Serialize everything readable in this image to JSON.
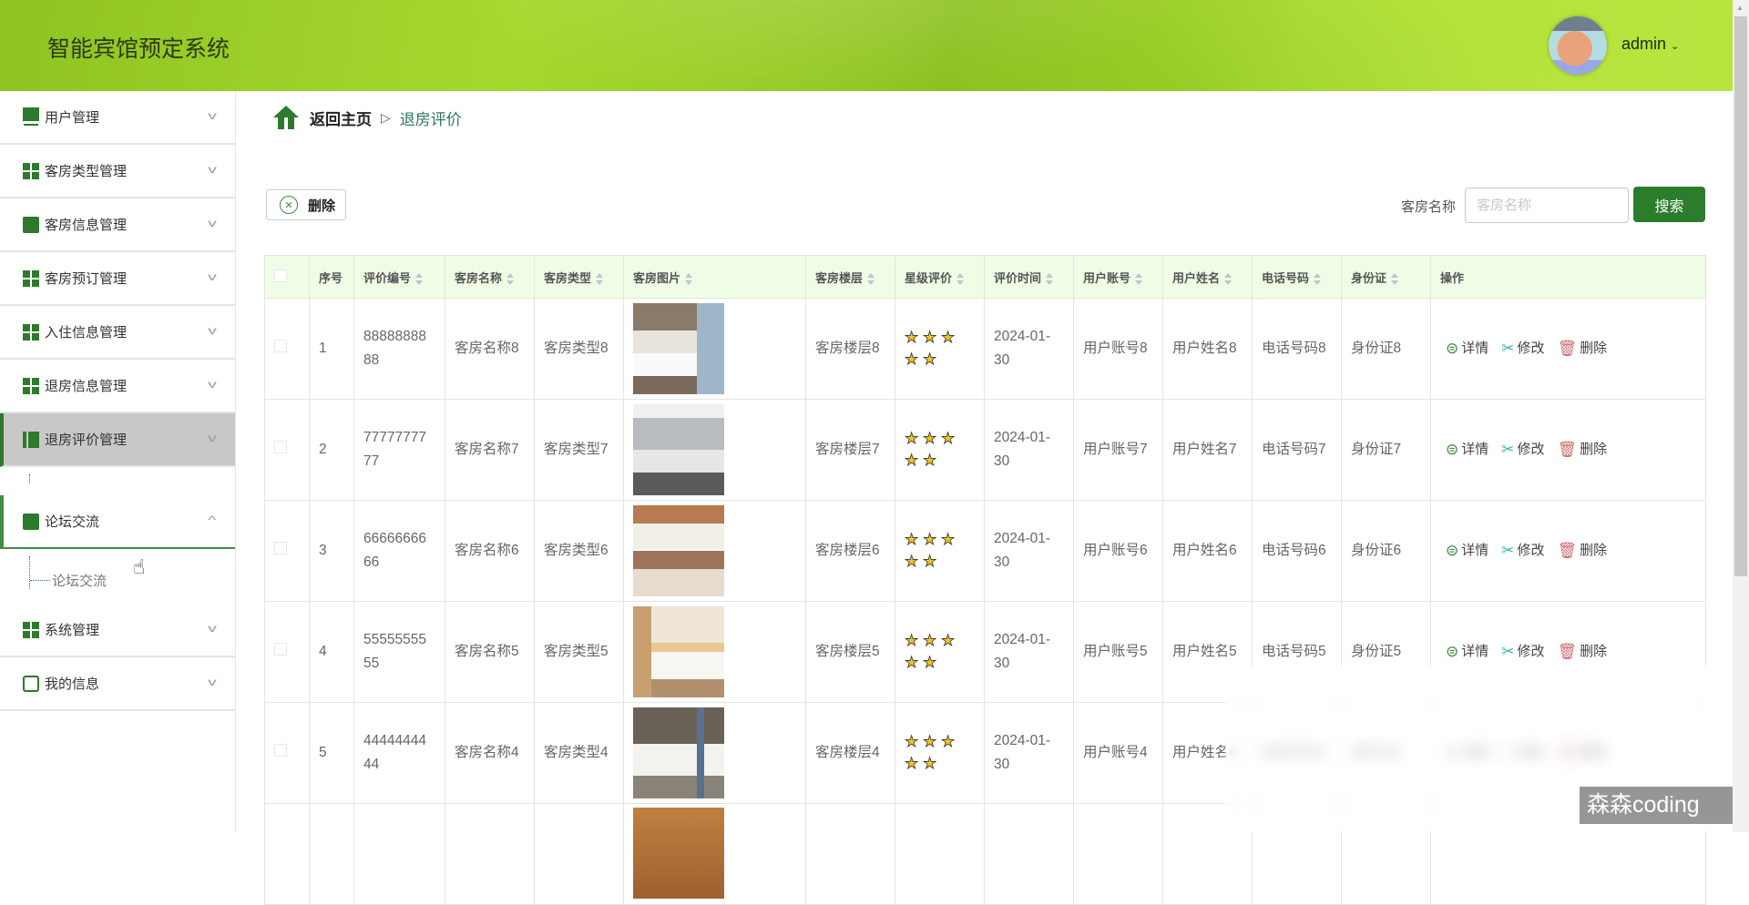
{
  "header": {
    "title": "智能宾馆预定系统",
    "username": "admin"
  },
  "sidebar": {
    "items": [
      {
        "label": "用户管理",
        "icon": "monitor-icon"
      },
      {
        "label": "客房类型管理",
        "icon": "grid-icon"
      },
      {
        "label": "客房信息管理",
        "icon": "chat-icon"
      },
      {
        "label": "客房预订管理",
        "icon": "grid-icon"
      },
      {
        "label": "入住信息管理",
        "icon": "grid9-icon"
      },
      {
        "label": "退房信息管理",
        "icon": "grid-icon"
      },
      {
        "label": "退房评价管理",
        "icon": "book-icon"
      },
      {
        "label": "论坛交流",
        "icon": "clipboard-icon",
        "sub": "论坛交流"
      },
      {
        "label": "系统管理",
        "icon": "grid-icon"
      },
      {
        "label": "我的信息",
        "icon": "card-icon"
      }
    ]
  },
  "breadcrumb": {
    "home": "返回主页",
    "separator": "▷",
    "current": "退房评价"
  },
  "toolbar": {
    "delete_label": "删除",
    "search_label": "客房名称",
    "search_placeholder": "客房名称",
    "search_value": "",
    "search_button": "搜索"
  },
  "table": {
    "headers": [
      "序号",
      "评价编号",
      "客房名称",
      "客房类型",
      "客房图片",
      "客房楼层",
      "星级评价",
      "评价时间",
      "用户账号",
      "用户姓名",
      "电话号码",
      "身份证",
      "操作"
    ],
    "actions": {
      "detail": "详情",
      "edit": "修改",
      "delete": "删除"
    },
    "rows": [
      {
        "index": "1",
        "code": "8888888888",
        "name": "客房名称8",
        "type": "客房类型8",
        "floor": "客房楼层8",
        "stars": 5,
        "time": "2024-01-30",
        "account": "用户账号8",
        "username": "用户姓名8",
        "phone": "电话号码8",
        "idcard": "身份证8"
      },
      {
        "index": "2",
        "code": "7777777777",
        "name": "客房名称7",
        "type": "客房类型7",
        "floor": "客房楼层7",
        "stars": 5,
        "time": "2024-01-30",
        "account": "用户账号7",
        "username": "用户姓名7",
        "phone": "电话号码7",
        "idcard": "身份证7"
      },
      {
        "index": "3",
        "code": "6666666666",
        "name": "客房名称6",
        "type": "客房类型6",
        "floor": "客房楼层6",
        "stars": 5,
        "time": "2024-01-30",
        "account": "用户账号6",
        "username": "用户姓名6",
        "phone": "电话号码6",
        "idcard": "身份证6"
      },
      {
        "index": "4",
        "code": "5555555555",
        "name": "客房名称5",
        "type": "客房类型5",
        "floor": "客房楼层5",
        "stars": 5,
        "time": "2024-01-30",
        "account": "用户账号5",
        "username": "用户姓名5",
        "phone": "电话号码5",
        "idcard": "身份证5"
      },
      {
        "index": "5",
        "code": "4444444444",
        "name": "客房名称4",
        "type": "客房类型4",
        "floor": "客房楼层4",
        "stars": 5,
        "time": "2024-01-30",
        "account": "用户账号4",
        "username": "用户姓名4",
        "phone": "电话号码4",
        "idcard": "身份证4"
      }
    ]
  },
  "watermark": "森森coding",
  "colors": {
    "accent": "#2b7d2b",
    "header_bg": "#a6d92e",
    "table_header_bg": "#effde6",
    "star": "#f5c518"
  }
}
